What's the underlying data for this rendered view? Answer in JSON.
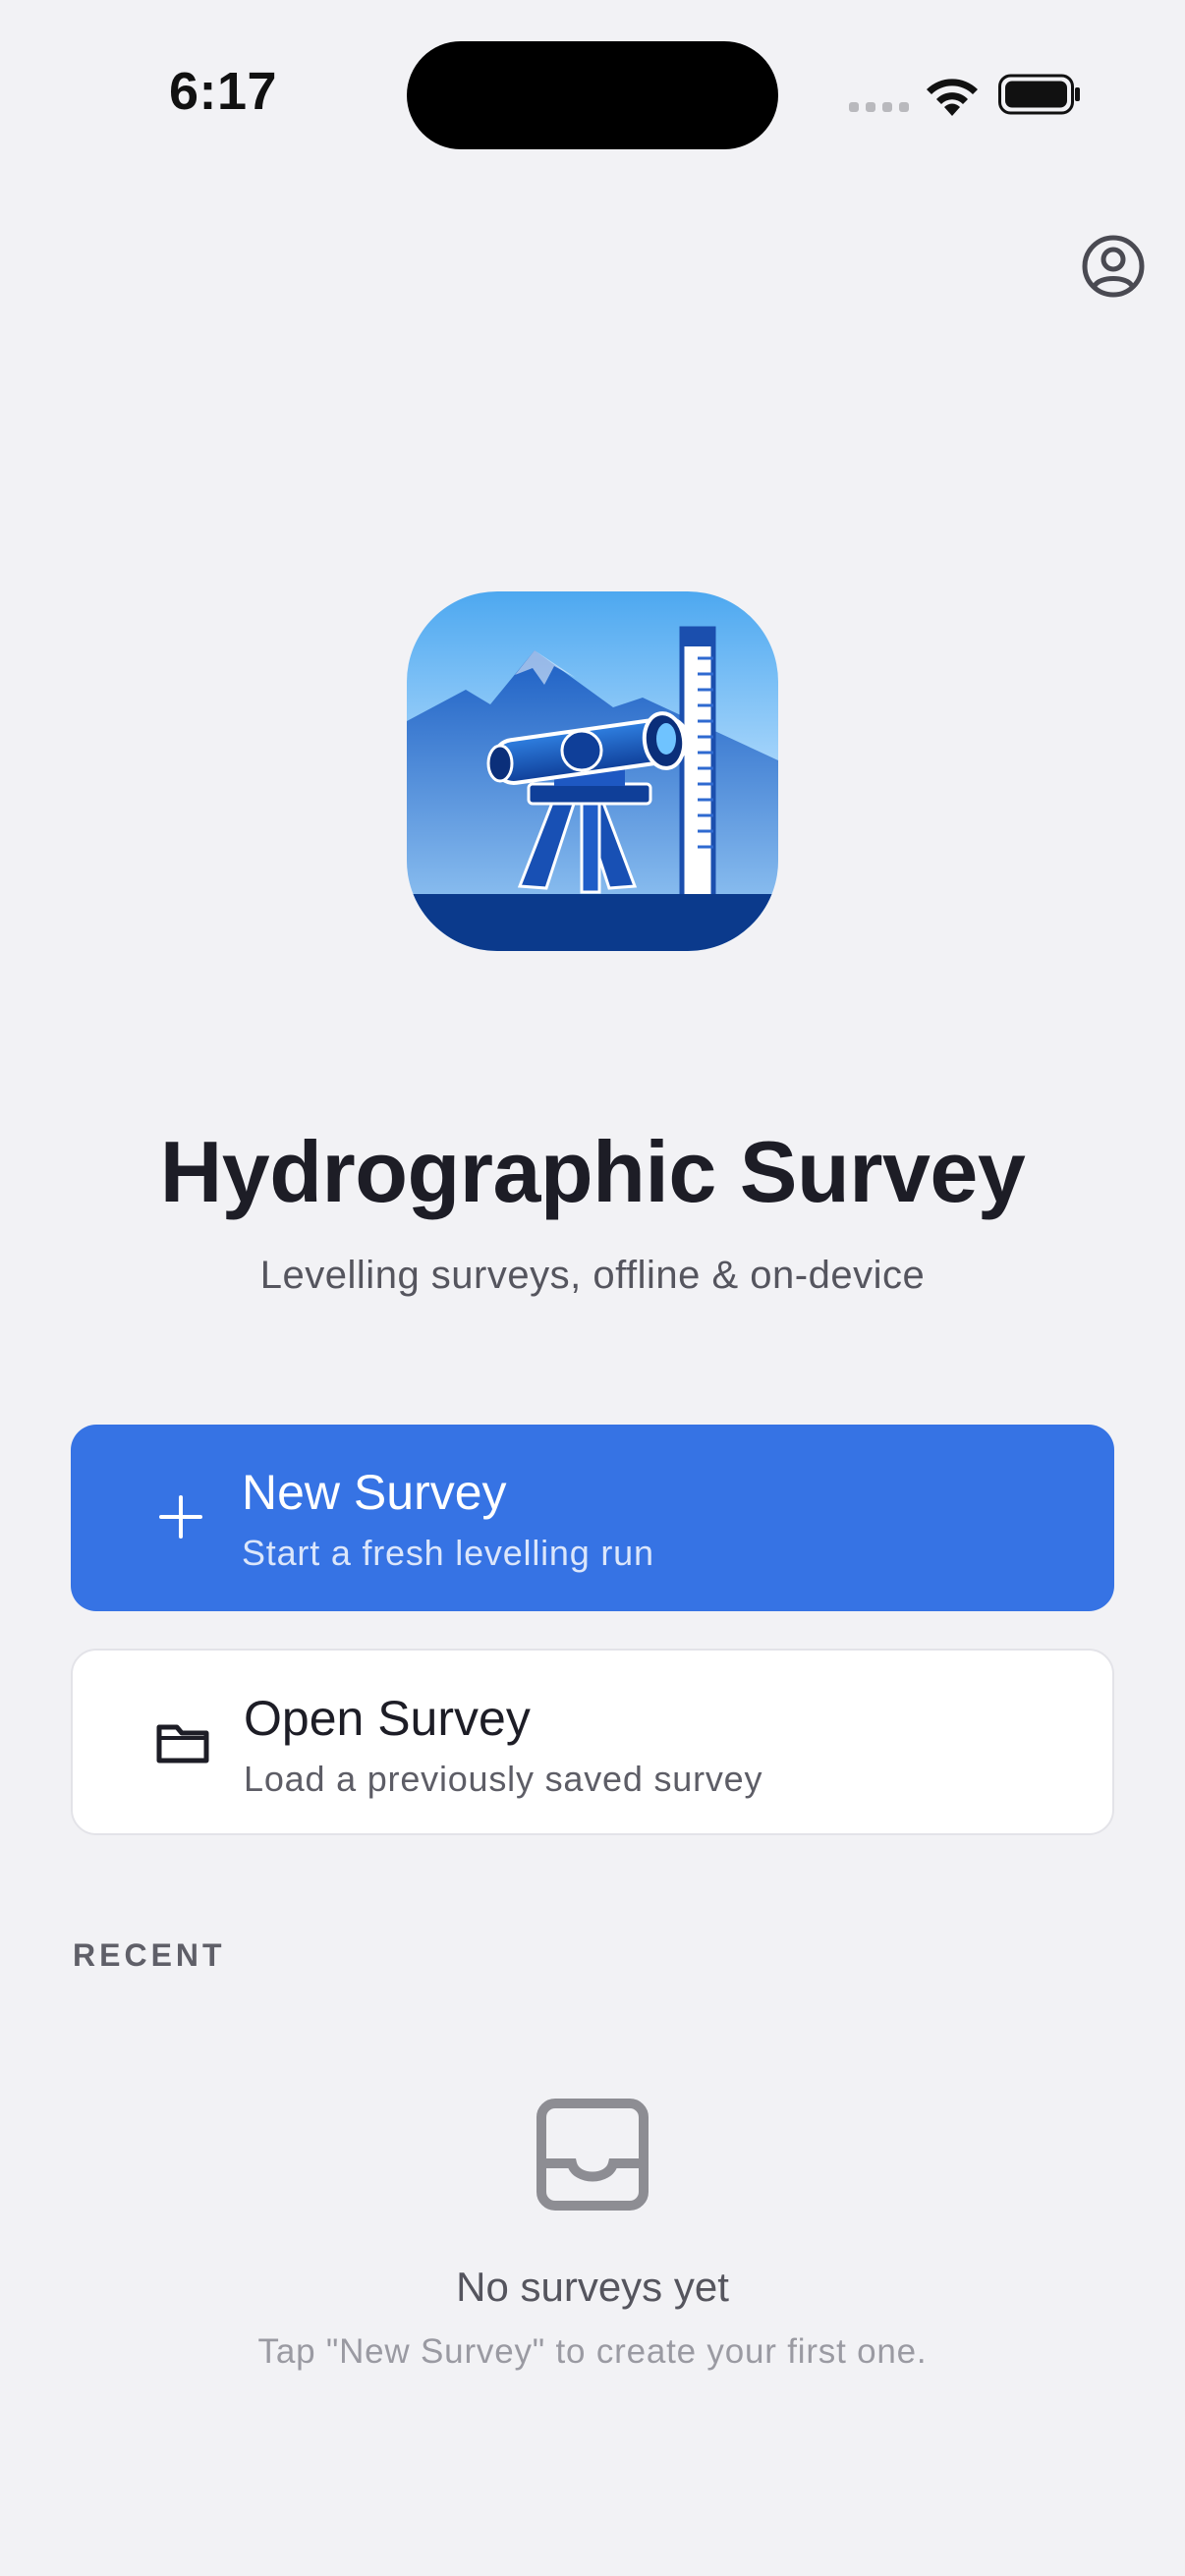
{
  "status_bar": {
    "time": "6:17"
  },
  "header": {
    "profile_icon": "user-circle-icon"
  },
  "app": {
    "logo_icon": "surveying-level-icon",
    "title": "Hydrographic Survey",
    "subtitle": "Levelling surveys, offline & on-device"
  },
  "actions": {
    "new_survey": {
      "icon": "plus-icon",
      "title": "New Survey",
      "subtitle": "Start a fresh levelling run"
    },
    "open_survey": {
      "icon": "folder-icon",
      "title": "Open Survey",
      "subtitle": "Load a previously saved survey"
    }
  },
  "recent": {
    "label": "RECENT",
    "empty_icon": "inbox-icon",
    "empty_title": "No surveys yet",
    "empty_subtitle": "Tap \"New Survey\" to create your first one."
  },
  "colors": {
    "background": "#f2f2f5",
    "accent": "#3673e4",
    "title": "#1d1d26"
  }
}
